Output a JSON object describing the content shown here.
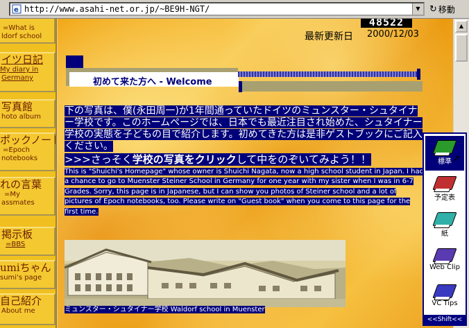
{
  "address_bar": {
    "url": "http://www.asahi-net.or.jp/~BE9H-NGT/",
    "go_label": "移動"
  },
  "left_nav": {
    "items": [
      {
        "jp": "",
        "en": "=What is"
      },
      {
        "jp": "",
        "en": "ldorf school"
      },
      {
        "jp": "イツ日記",
        "en": "My diary in"
      },
      {
        "jp": "",
        "en": "Germany"
      },
      {
        "jp": "写真館",
        "en": "hoto album"
      },
      {
        "jp": "ポックノート",
        "en": "=Epoch"
      },
      {
        "jp": "",
        "en": "notebooks"
      },
      {
        "jp": "れの言葉",
        "en": "=My"
      },
      {
        "jp": "",
        "en": "assmates"
      },
      {
        "jp": "掲示板",
        "en": "=BBS"
      },
      {
        "jp": "umiちゃん",
        "en": "sumi's page"
      },
      {
        "jp": "自己紹介",
        "en": "About me"
      }
    ]
  },
  "main": {
    "counter": "48522",
    "updated_label": "最新更新日",
    "updated_date": "2000/12/03",
    "welcome": "初めて来た方へ - Welcome",
    "intro_jp": "下の写真は、僕(永田周一)が1年間通っていたドイツのミュンスター・シュタイナー学校です。このホームページでは、日本でも最近注目され始めた、シュタイナー学校の実態を子どもの目で紹介します。初めてきた方は是非ゲストブックにご記入ください。",
    "intro_click_prefix": ">>>さっそく",
    "intro_click_bold": "学校の写真をクリック",
    "intro_click_suffix": "して中をのぞいてみよう！！",
    "intro_en": "This is \"Shuichi's Homepage\" whose owner is Shuichi Nagata, now  a high school student in Japan. I had a chance to go to Muenster Steiner School in Germany for one year with my sister when I was in 6-7 Grades. Sorry, this page is in Japanese, but I can show you photos of Steiner school and a lot of pictures of Epoch notebooks, too. Please write on \"Guest book\" when you come to this page for the first time.",
    "photo_caption": "ミュンスター・シュタイナー学校  Waldorf school in Muenster"
  },
  "palette": {
    "items": [
      {
        "label": "標準",
        "color": "#2a9a2a"
      },
      {
        "label": "予定表",
        "color": "#c03030"
      },
      {
        "label": "紙",
        "color": "#30b0a8"
      },
      {
        "label": "Web Clip",
        "color": "#5a3ab0"
      },
      {
        "label": "VC Tips",
        "color": "#3a3ac0"
      }
    ],
    "footer": "<<Shift<<"
  },
  "colors": {
    "selection": "#00007a",
    "nav_bg": "#f0c020",
    "nav_text": "#6a1e00"
  }
}
